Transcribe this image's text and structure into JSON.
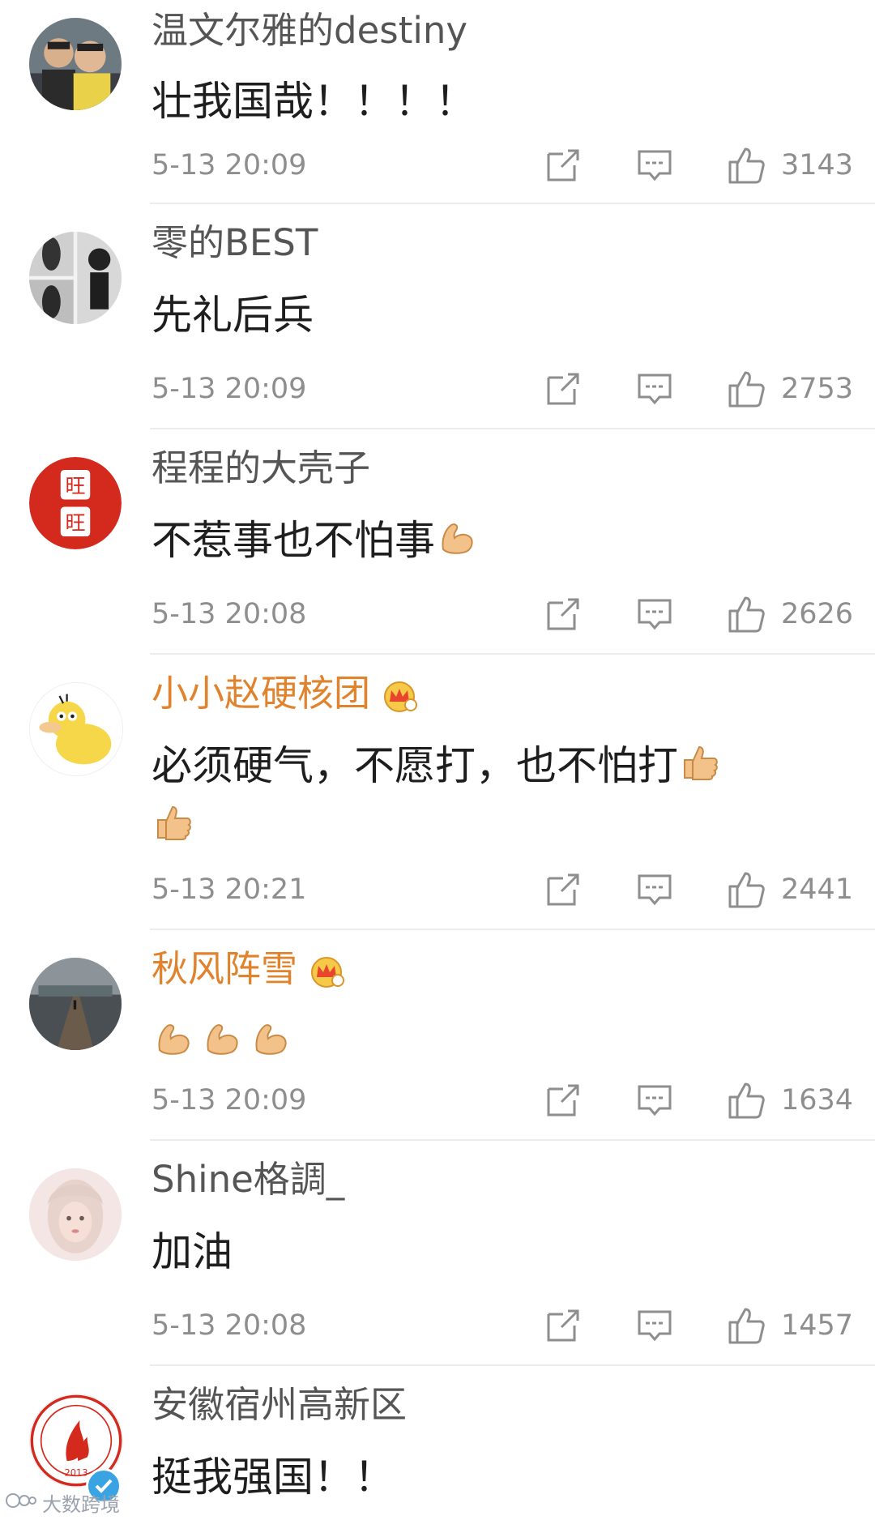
{
  "comments": [
    {
      "name": "温文尔雅的destiny",
      "text": "壮我国哉！！！！",
      "time": "5-13 20:09",
      "likes": "3143",
      "vip": false
    },
    {
      "name": "零的BEST",
      "text": "先礼后兵",
      "time": "5-13 20:09",
      "likes": "2753",
      "vip": false
    },
    {
      "name": "程程的大壳子",
      "text": "不惹事也不怕事",
      "time": "5-13 20:08",
      "likes": "2626",
      "vip": false,
      "emoji": "flexed-biceps"
    },
    {
      "name": "小小赵硬核团",
      "text": "必须硬气，不愿打，也不怕打",
      "time": "5-13 20:21",
      "likes": "2441",
      "vip": true,
      "emoji": "thumbs-up x2"
    },
    {
      "name": "秋风阵雪",
      "text": "",
      "time": "5-13 20:09",
      "likes": "1634",
      "vip": true,
      "emoji": "flexed-biceps x3"
    },
    {
      "name": "Shine格調_",
      "text": "加油",
      "time": "5-13 20:08",
      "likes": "1457",
      "vip": false
    },
    {
      "name": "安徽宿州高新区",
      "text": "挺我强国！！",
      "time": "",
      "likes": "",
      "vip": false,
      "verified": true
    }
  ],
  "avatar_badge": {
    "year": "2013"
  },
  "icons": {
    "share": "share-icon",
    "reply": "comment-icon",
    "like": "thumbs-up-icon"
  },
  "colors": {
    "vip_name": "#e0832c",
    "name": "#555555",
    "meta": "#8e8e8e",
    "divider": "#ececec"
  },
  "watermark": {
    "text": "大数跨境"
  }
}
